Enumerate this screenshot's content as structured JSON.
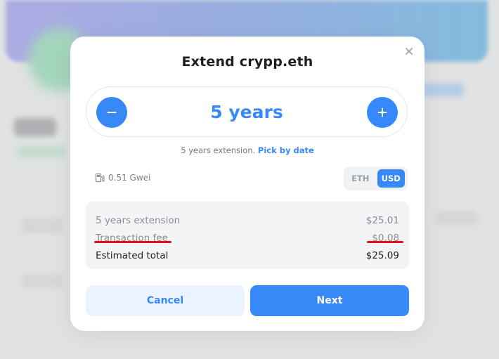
{
  "modal": {
    "title": "Extend crypp.eth",
    "duration_value": "5 years",
    "extension_text": "5 years extension.",
    "pick_date_link": "Pick by date",
    "gas_price": "0.51 Gwei",
    "currency_options": [
      "ETH",
      "USD"
    ],
    "selected_currency": "USD",
    "summary": [
      {
        "label": "5 years extension",
        "amount": "$25.01"
      },
      {
        "label": "Transaction fee",
        "amount": "$0.08"
      },
      {
        "label": "Estimated total",
        "amount": "$25.09"
      }
    ],
    "cancel_label": "Cancel",
    "next_label": "Next"
  },
  "colors": {
    "accent": "#3889f8",
    "annotation_underline": "#e0141b"
  },
  "icons": {
    "close": "close-icon",
    "minus": "minus-icon",
    "plus": "plus-icon",
    "gas": "gas-pump-icon"
  }
}
